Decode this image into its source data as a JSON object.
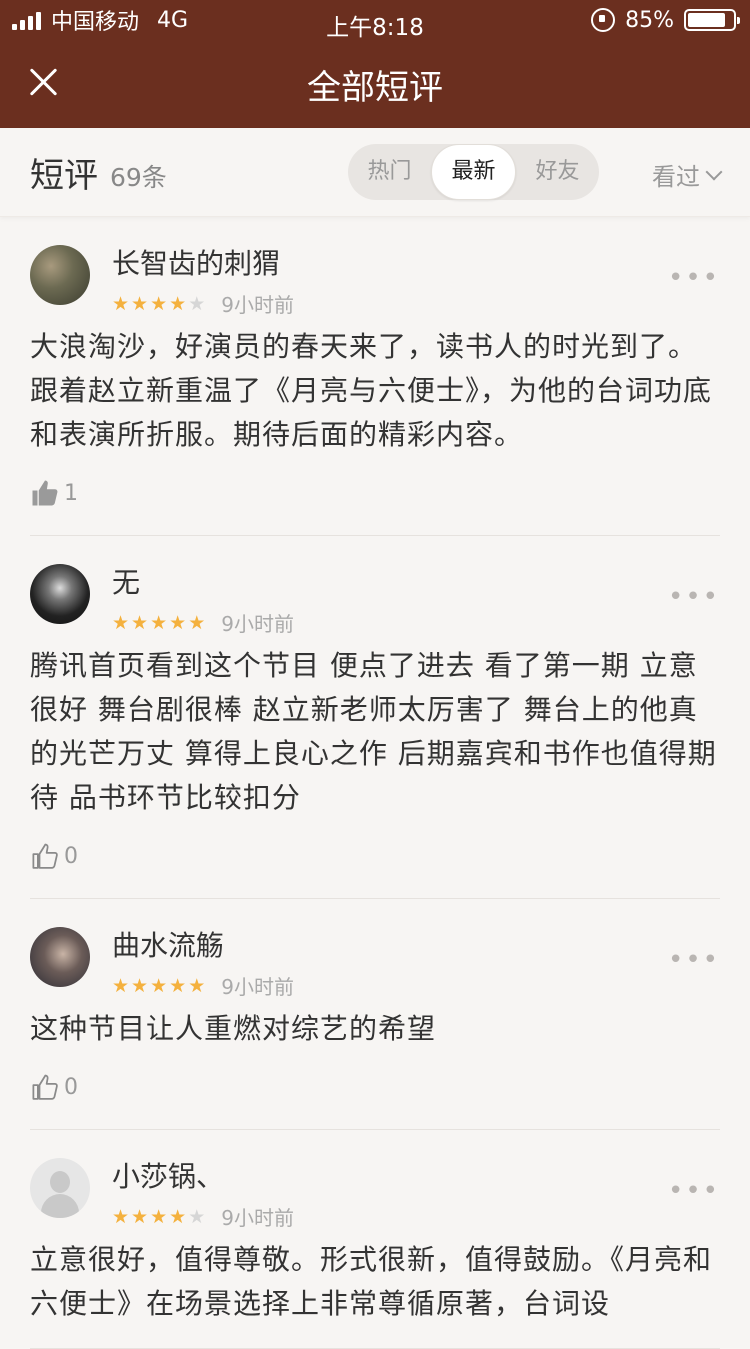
{
  "status_bar": {
    "carrier": "中国移动",
    "network": "4G",
    "time": "上午8:18",
    "battery": "85%",
    "battery_level": 0.85
  },
  "header": {
    "title": "全部短评"
  },
  "toolbar": {
    "title": "短评",
    "count": "69条",
    "tabs": [
      {
        "label": "热门"
      },
      {
        "label": "最新"
      },
      {
        "label": "好友"
      }
    ],
    "active_tab": "最新",
    "filter_label": "看过"
  },
  "colors": {
    "header_bg": "#6b2f1f",
    "star": "#f4b13e",
    "star_off": "#d6d6d6"
  },
  "reviews": [
    {
      "name": "长智齿的刺猬",
      "rating": 4,
      "time": "9小时前",
      "text": "大浪淘沙，好演员的春天来了，读书人的时光到了。跟着赵立新重温了《月亮与六便士》，为他的台词功底和表演所折服。期待后面的精彩内容。",
      "likes": "1",
      "liked": true
    },
    {
      "name": "无",
      "rating": 5,
      "time": "9小时前",
      "text": "腾讯首页看到这个节目 便点了进去 看了第一期 立意很好 舞台剧很棒 赵立新老师太厉害了 舞台上的他真的光芒万丈 算得上良心之作 后期嘉宾和书作也值得期待 品书环节比较扣分",
      "likes": "0",
      "liked": false
    },
    {
      "name": "曲水流觞",
      "rating": 5,
      "time": "9小时前",
      "text": "这种节目让人重燃对综艺的希望",
      "likes": "0",
      "liked": false
    },
    {
      "name": "小莎锅、",
      "rating": 4,
      "time": "9小时前",
      "text": "立意很好，值得尊敬。形式很新，值得鼓励。《月亮和六便士》在场景选择上非常尊循原著，台词设",
      "likes": "",
      "liked": false
    }
  ]
}
